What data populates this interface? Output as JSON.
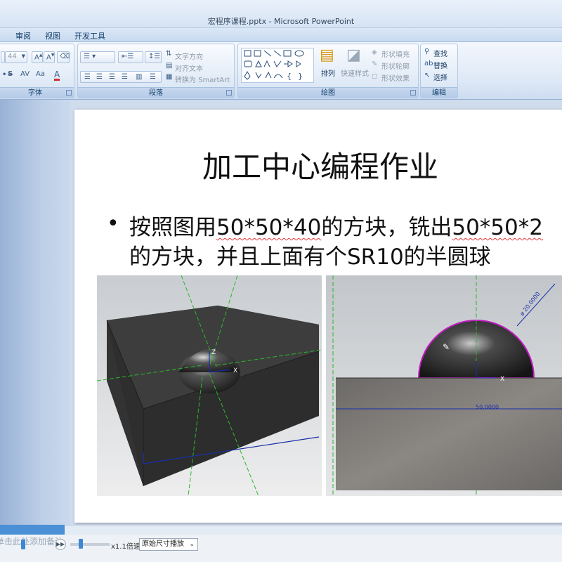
{
  "window": {
    "title": "宏程序课程.pptx - Microsoft PowerPoint"
  },
  "tabs": [
    "审阅",
    "视图",
    "开发工具"
  ],
  "ribbon": {
    "font_group": {
      "label": "字体",
      "size_value": "44"
    },
    "paragraph_group": {
      "label": "段落",
      "text_direction": "文字方向",
      "align_text": "对齐文本",
      "convert_smartart": "转换为 SmartArt"
    },
    "drawing_group": {
      "label": "绘图",
      "arrange": "排列",
      "quick_styles": "快速样式",
      "shape_fill": "形状填充",
      "shape_outline": "形状轮廓",
      "shape_effects": "形状效果"
    },
    "editing_group": {
      "label": "编辑",
      "find": "查找",
      "replace": "替换",
      "select": "选择"
    }
  },
  "slide": {
    "title": "加工中心编程作业",
    "bullet_line1_a": "按照图用",
    "bullet_line1_b": "50*50*40",
    "bullet_line1_c": "的方块，铣出",
    "bullet_line1_d": "50*50*2",
    "bullet_line2": "的方块，并且上面有个SR10的半圆球",
    "image2": {
      "dim_diameter": "ø 20.0000",
      "dim_width": "50.0000"
    }
  },
  "notes": {
    "placeholder": "单击此处添加备注"
  },
  "player": {
    "speed": "x1.1倍速",
    "size_mode": "原始尺寸播放"
  },
  "colors": {
    "ribbon_text": "#15406b",
    "progress": "#4b8fd6",
    "squiggle": "#e03b3b"
  }
}
